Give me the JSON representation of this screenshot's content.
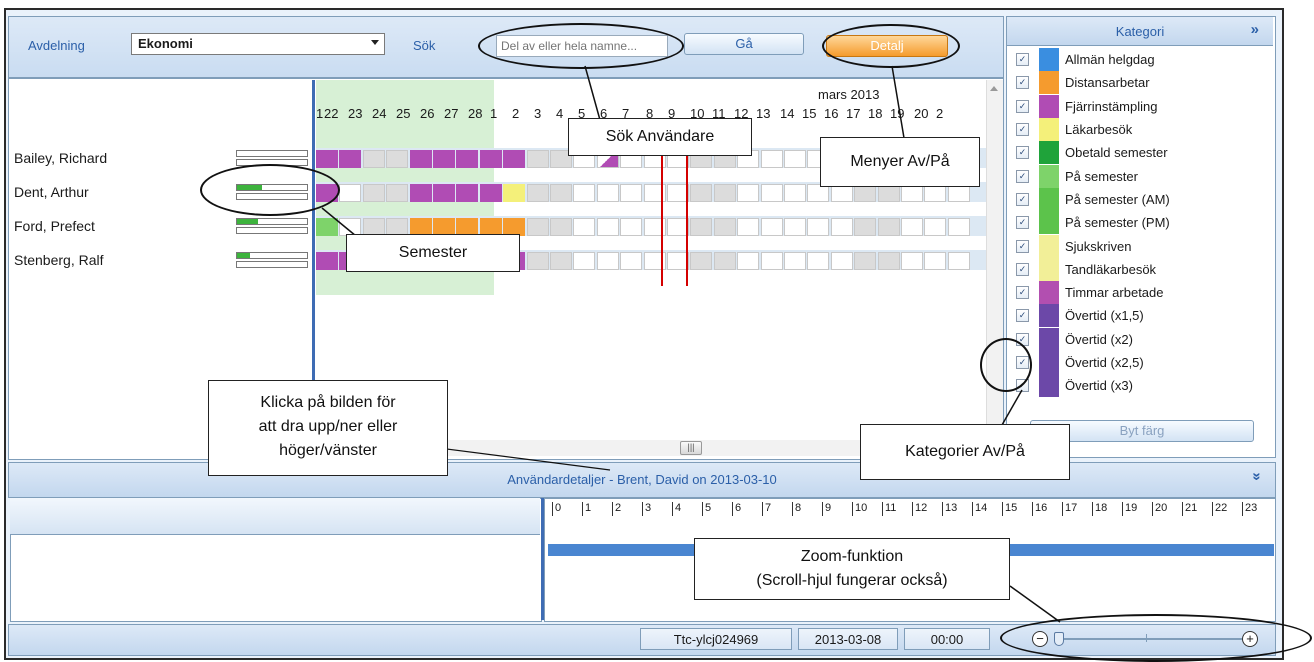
{
  "toolbar": {
    "department_label": "Avdelning",
    "department_value": "Ekonomi",
    "search_label": "Sök",
    "search_placeholder": "Del av eller hela namne...",
    "go_button": "Gå",
    "detail_button": "Detalj"
  },
  "calendar": {
    "month_label": "mars 2013",
    "days": [
      "1",
      "22",
      "23",
      "24",
      "25",
      "26",
      "27",
      "28",
      "1",
      "2",
      "3",
      "4",
      "5",
      "6",
      "7",
      "8",
      "9",
      "10",
      "11",
      "12",
      "13",
      "14",
      "15",
      "16",
      "17",
      "18",
      "19",
      "20",
      "2"
    ]
  },
  "people": [
    {
      "name": "Bailey, Richard",
      "vacation_used": 0.0
    },
    {
      "name": "Dent, Arthur",
      "vacation_used": 0.35
    },
    {
      "name": "Ford, Prefect",
      "vacation_used": 0.3
    },
    {
      "name": "Stenberg, Ralf",
      "vacation_used": 0.18
    }
  ],
  "category_panel": {
    "title": "Kategori",
    "collapse_icon": "»",
    "change_color_button": "Byt färg",
    "items": [
      {
        "label": "Allmän helgdag",
        "color": "#3a8ee0"
      },
      {
        "label": "Distansarbetar",
        "color": "#f59b2e"
      },
      {
        "label": "Fjärrinstämpling",
        "color": "#b04cb4"
      },
      {
        "label": "Läkarbesök",
        "color": "#f4f07a"
      },
      {
        "label": "Obetald semester",
        "color": "#1fa33a"
      },
      {
        "label": "På semester",
        "color": "#7ed36a"
      },
      {
        "label": "På semester (AM)",
        "color": "#5cc34b"
      },
      {
        "label": "På semester (PM)",
        "color": "#5cc34b"
      },
      {
        "label": "Sjukskriven",
        "color": "#f2ef98"
      },
      {
        "label": "Tandläkarbesök",
        "color": "#f2ef98"
      },
      {
        "label": "Timmar arbetade",
        "color": "#b24fb0"
      },
      {
        "label": "Övertid (x1,5)",
        "color": "#6c48a8"
      },
      {
        "label": "Övertid (x2)",
        "color": "#6c48a8"
      },
      {
        "label": "Övertid (x2,5)",
        "color": "#6c48a8"
      },
      {
        "label": "Övertid (x3)",
        "color": "#6c48a8"
      }
    ]
  },
  "details": {
    "title": "Användardetaljer - Brent, David on 2013-03-10",
    "expand_icon": "»",
    "hours": [
      "0",
      "1",
      "2",
      "3",
      "4",
      "5",
      "6",
      "7",
      "8",
      "9",
      "10",
      "11",
      "12",
      "13",
      "14",
      "15",
      "16",
      "17",
      "18",
      "19",
      "20",
      "21",
      "22",
      "23"
    ]
  },
  "status": {
    "machine": "Ttc-ylcj024969",
    "date": "2013-03-08",
    "time": "00:00",
    "zoom_out": "−",
    "zoom_in": "+"
  },
  "callouts": {
    "search_users": "Sök Användare",
    "menus_toggle": "Menyer Av/På",
    "vacation": "Semester",
    "drag_hint_1": "Klicka på bilden för",
    "drag_hint_2": "att dra upp/ner eller",
    "drag_hint_3": "höger/vänster",
    "categories_toggle": "Kategorier Av/På",
    "zoom_1": "Zoom-funktion",
    "zoom_2": "(Scroll-hjul fungerar också)"
  },
  "colors": {
    "accent": "#3e6cb4",
    "worked": "#b04cb4",
    "remote": "#f59b2e",
    "doctor": "#f4f07a",
    "vacation": "#7ed36a",
    "marker": "#d40000"
  }
}
